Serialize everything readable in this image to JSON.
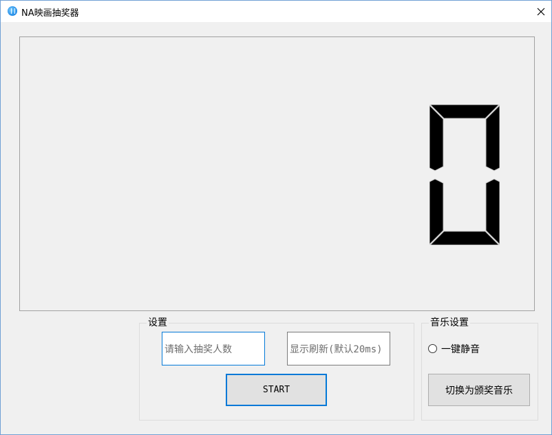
{
  "window": {
    "title": "NA映画抽奖器",
    "close_glyph": "✕",
    "app_icon": "app-logo-icon"
  },
  "display": {
    "digit": "0",
    "digit_style": "seven-segment"
  },
  "settings": {
    "group_label": "设置",
    "count_placeholder": "请输入抽奖人数",
    "refresh_placeholder": "显示刷新(默认20ms)",
    "start_label": "START"
  },
  "music": {
    "group_label": "音乐设置",
    "mute_label": "一键静音",
    "mute_checked": false,
    "switch_label": "切换为颁奖音乐"
  },
  "colors": {
    "accent": "#0078d7",
    "background": "#f0f0f0",
    "segment": "#000000"
  }
}
